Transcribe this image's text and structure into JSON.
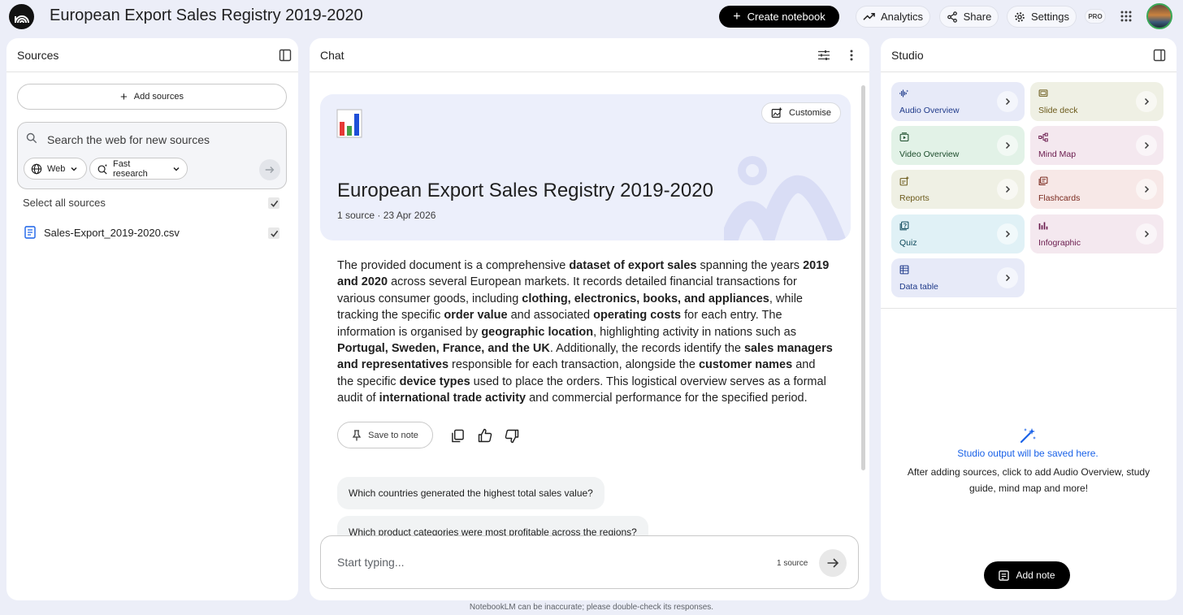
{
  "header": {
    "title": "European Export Sales Registry 2019-2020",
    "create_label": "Create notebook",
    "analytics_label": "Analytics",
    "share_label": "Share",
    "settings_label": "Settings",
    "pro_badge": "PRO"
  },
  "sources": {
    "title": "Sources",
    "add_label": "Add sources",
    "search_placeholder": "Search the web for new sources",
    "web_chip": "Web",
    "research_chip": "Fast research",
    "select_all": "Select all sources",
    "items": [
      {
        "name": "Sales-Export_2019-2020.csv",
        "checked": true
      }
    ]
  },
  "chat": {
    "title": "Chat",
    "customise_label": "Customise",
    "notebook_title": "European Export Sales Registry 2019-2020",
    "meta": "1 source · 23 Apr 2026",
    "summary": [
      {
        "t": "The provided document is a comprehensive "
      },
      {
        "t": "dataset of export sales",
        "b": true
      },
      {
        "t": " spanning the years "
      },
      {
        "t": "2019 and 2020",
        "b": true
      },
      {
        "t": " across several European markets. It records detailed financial transactions for various consumer goods, including "
      },
      {
        "t": "clothing, electronics, books, and appliances",
        "b": true
      },
      {
        "t": ", while tracking the specific "
      },
      {
        "t": "order value",
        "b": true
      },
      {
        "t": " and associated "
      },
      {
        "t": "operating costs",
        "b": true
      },
      {
        "t": " for each entry. The information is organised by "
      },
      {
        "t": "geographic location",
        "b": true
      },
      {
        "t": ", highlighting activity in nations such as "
      },
      {
        "t": "Portugal, Sweden, France, and the UK",
        "b": true
      },
      {
        "t": ". Additionally, the records identify the "
      },
      {
        "t": "sales managers and representatives",
        "b": true
      },
      {
        "t": " responsible for each transaction, alongside the "
      },
      {
        "t": "customer names",
        "b": true
      },
      {
        "t": " and the specific "
      },
      {
        "t": "device types",
        "b": true
      },
      {
        "t": " used to place the orders. This logistical overview serves as a formal audit of "
      },
      {
        "t": "international trade activity",
        "b": true
      },
      {
        "t": " and commercial performance for the specified period."
      }
    ],
    "save_label": "Save to note",
    "suggestions": [
      "Which countries generated the highest total sales value?",
      "Which product categories were most profitable across the regions?"
    ],
    "input_placeholder": "Start typing...",
    "source_count": "1 source"
  },
  "studio": {
    "title": "Studio",
    "tiles": [
      {
        "label": "Audio Overview",
        "icon": "audio-icon",
        "bg": "#e7eaf8",
        "fg": "#1f3a8a"
      },
      {
        "label": "Slide deck",
        "icon": "slides-icon",
        "bg": "#eff0e4",
        "fg": "#6b5a1a"
      },
      {
        "label": "Video Overview",
        "icon": "video-icon",
        "bg": "#e2f2e7",
        "fg": "#1d4d2c"
      },
      {
        "label": "Mind Map",
        "icon": "mindmap-icon",
        "bg": "#f4e8ef",
        "fg": "#6a1b4d"
      },
      {
        "label": "Reports",
        "icon": "reports-icon",
        "bg": "#eff0e4",
        "fg": "#6b5a1a"
      },
      {
        "label": "Flashcards",
        "icon": "flashcards-icon",
        "bg": "#f7e8e7",
        "fg": "#7a2a1f"
      },
      {
        "label": "Quiz",
        "icon": "quiz-icon",
        "bg": "#e0f1f6",
        "fg": "#0e4a5c"
      },
      {
        "label": "Infographic",
        "icon": "infographic-icon",
        "bg": "#f4e8ef",
        "fg": "#6a1b4d"
      },
      {
        "label": "Data table",
        "icon": "datatable-icon",
        "bg": "#e7eaf8",
        "fg": "#1f3a8a"
      }
    ],
    "empty_title": "Studio output will be saved here.",
    "empty_desc": "After adding sources, click to add Audio Overview, study guide, mind map and more!",
    "add_note_label": "Add note"
  },
  "footer": "NotebookLM can be inaccurate; please double-check its responses."
}
